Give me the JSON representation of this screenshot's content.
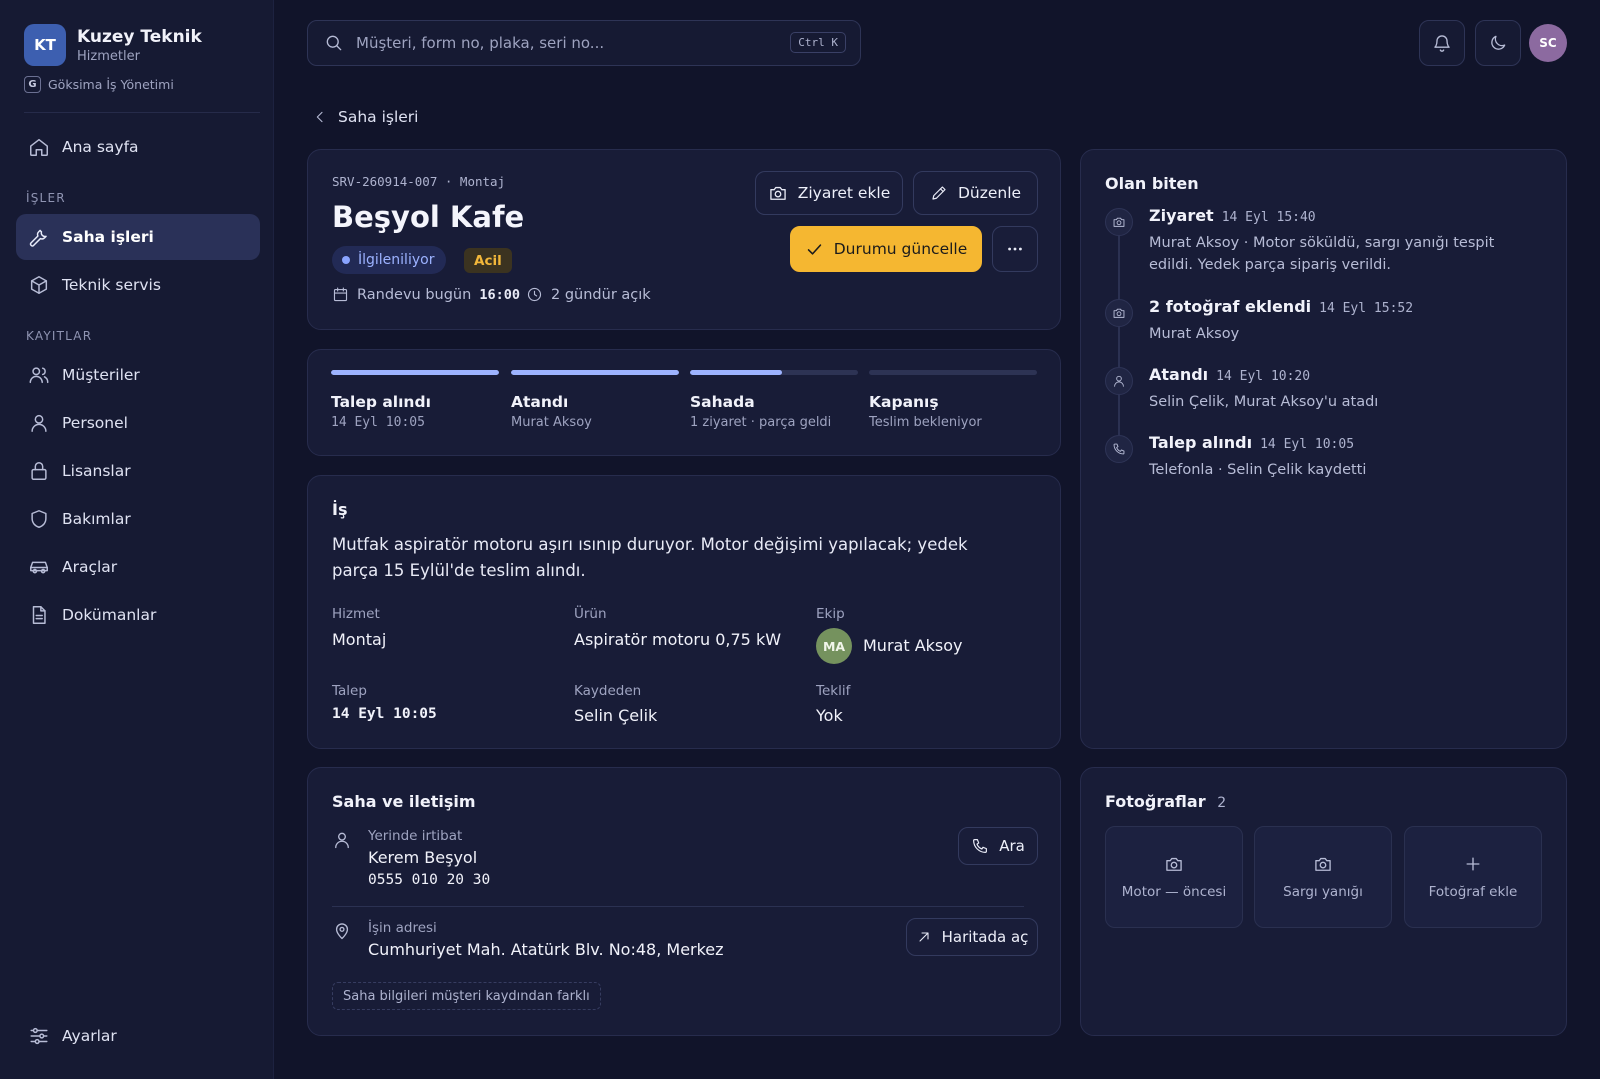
{
  "brand": {
    "initials": "KT",
    "name": "Kuzey Teknik",
    "subtitle": "Hizmetler",
    "org_badge": "G",
    "org_name": "Göksima İş Yönetimi"
  },
  "sidebar": {
    "home": "Ana sayfa",
    "section_jobs": "İŞLER",
    "field_jobs": "Saha işleri",
    "tech_service": "Teknik servis",
    "section_records": "KAYITLAR",
    "customers": "Müşteriler",
    "staff": "Personel",
    "licenses": "Lisanslar",
    "maintenance": "Bakımlar",
    "vehicles": "Araçlar",
    "documents": "Dokümanlar",
    "settings": "Ayarlar"
  },
  "topbar": {
    "search_placeholder": "Müşteri, form no, plaka, seri no...",
    "shortcut": "Ctrl K",
    "user_initials": "SC"
  },
  "breadcrumb": {
    "back_label": "Saha işleri"
  },
  "job": {
    "id_line": "SRV-260914-007 · Montaj",
    "title": "Beşyol Kafe",
    "status": "İlgileniliyor",
    "priority": "Acil",
    "appointment_label": "Randevu bugün",
    "appointment_time": "16:00",
    "open_duration": "2 gündür açık",
    "add_visit_label": "Ziyaret ekle",
    "edit_label": "Düzenle",
    "update_status_label": "Durumu güncelle",
    "accent_color": "#f5b731"
  },
  "progress": [
    {
      "title": "Talep alındı",
      "sub": "14 Eyl 10:05",
      "fill": 1.0
    },
    {
      "title": "Atandı",
      "sub": "Murat Aksoy",
      "fill": 1.0
    },
    {
      "title": "Sahada",
      "sub": "1 ziyaret · parça geldi",
      "fill": 0.55
    },
    {
      "title": "Kapanış",
      "sub": "Teslim bekleniyor",
      "fill": 0.0
    }
  ],
  "work": {
    "heading": "İş",
    "description": "Mutfak aspiratör motoru aşırı ısınıp duruyor. Motor değişimi yapılacak; yedek parça 15 Eylül'de teslim alındı.",
    "service_label": "Hizmet",
    "service": "Montaj",
    "product_label": "Ürün",
    "product": "Aspiratör motoru 0,75 kW",
    "team_label": "Ekip",
    "team_initials": "MA",
    "team_member": "Murat Aksoy",
    "request_label": "Talep",
    "request": "14 Eyl 10:05",
    "recorded_by_label": "Kaydeden",
    "recorded_by": "Selin Çelik",
    "offer_label": "Teklif",
    "offer": "Yok"
  },
  "site": {
    "heading": "Saha ve iletişim",
    "contact_label": "Yerinde irtibat",
    "contact_name": "Kerem Beşyol",
    "contact_phone": "0555 010 20 30",
    "call_label": "Ara",
    "address_label": "İşin adresi",
    "address": "Cumhuriyet Mah. Atatürk Blv. No:48, Merkez",
    "map_label": "Haritada aç",
    "note": "Saha bilgileri müşteri kaydından farklı"
  },
  "timeline": {
    "heading": "Olan biten",
    "events": [
      {
        "icon": "camera-icon",
        "title": "Ziyaret",
        "time": "14 Eyl 15:40",
        "text": "Murat Aksoy · Motor söküldü, sargı yanığı tespit edildi. Yedek parça sipariş verildi."
      },
      {
        "icon": "camera-icon",
        "title": "2 fotoğraf eklendi",
        "time": "14 Eyl 15:52",
        "text": "Murat Aksoy"
      },
      {
        "icon": "person-icon",
        "title": "Atandı",
        "time": "14 Eyl 10:20",
        "text": "Selin Çelik, Murat Aksoy'u atadı"
      },
      {
        "icon": "phone-icon",
        "title": "Talep alındı",
        "time": "14 Eyl 10:05",
        "text": "Telefonla · Selin Çelik kaydetti"
      }
    ]
  },
  "photos": {
    "heading": "Fotoğraflar",
    "count": "2",
    "items": [
      {
        "label": "Motor — öncesi",
        "icon": "camera-icon"
      },
      {
        "label": "Sargı yanığı",
        "icon": "camera-icon"
      }
    ],
    "add_label": "Fotoğraf ekle"
  }
}
